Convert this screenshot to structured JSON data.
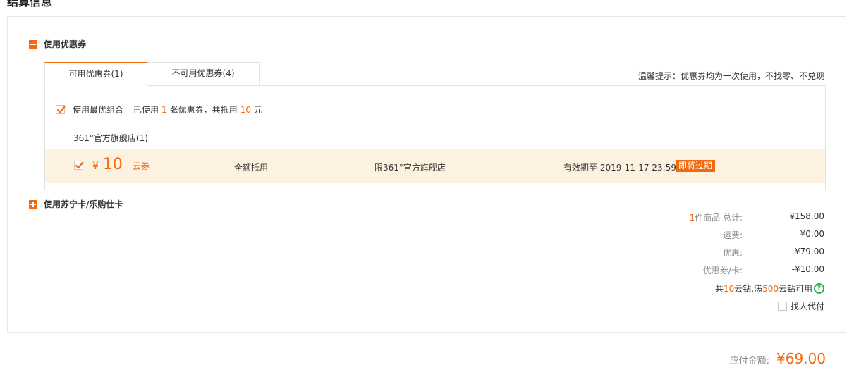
{
  "page": {
    "title": "结算信息"
  },
  "coupon_section": {
    "label": "使用优惠券",
    "tabs": [
      {
        "label": "可用优惠券(1)",
        "active": true
      },
      {
        "label": "不可用优惠券(4)",
        "active": false
      }
    ],
    "tip": "温馨提示：优惠券均为一次使用，不找零、不兑现",
    "best_combo": {
      "label": "使用最优组合",
      "used_prefix": "已使用",
      "used_count": "1",
      "used_mid": "张优惠券，共抵用",
      "used_amount": "10",
      "used_suffix": "元",
      "checked": true
    },
    "shop": "361°官方旗舰店(1)",
    "coupon": {
      "checked": true,
      "currency": "¥",
      "amount": "10",
      "kind": "云券",
      "deduction": "全额抵用",
      "limit": "限361°官方旗舰店",
      "valid_until": "有效期至 2019-11-17 23:59",
      "badge": "即将过期"
    }
  },
  "card_section": {
    "label": "使用苏宁卡/乐购仕卡"
  },
  "summary": {
    "items_count": "1",
    "items_label": "件商品 总计:",
    "items_total": "¥158.00",
    "shipping_label": "运费:",
    "shipping": "¥0.00",
    "discount_label": "优惠:",
    "discount": "-¥79.00",
    "coupon_label": "优惠券/卡:",
    "coupon": "-¥10.00",
    "yun_prefix": "共",
    "yun_count": "10",
    "yun_mid": "云钻,满",
    "yun_threshold": "500",
    "yun_suffix": "云钻可用",
    "proxy_pay": "找人代付"
  },
  "total": {
    "label": "应付金额:",
    "value": "¥69.00"
  },
  "colors": {
    "accent": "#f26a10",
    "highlight_row": "#fdf2e0",
    "help_green": "#2ab24a"
  }
}
